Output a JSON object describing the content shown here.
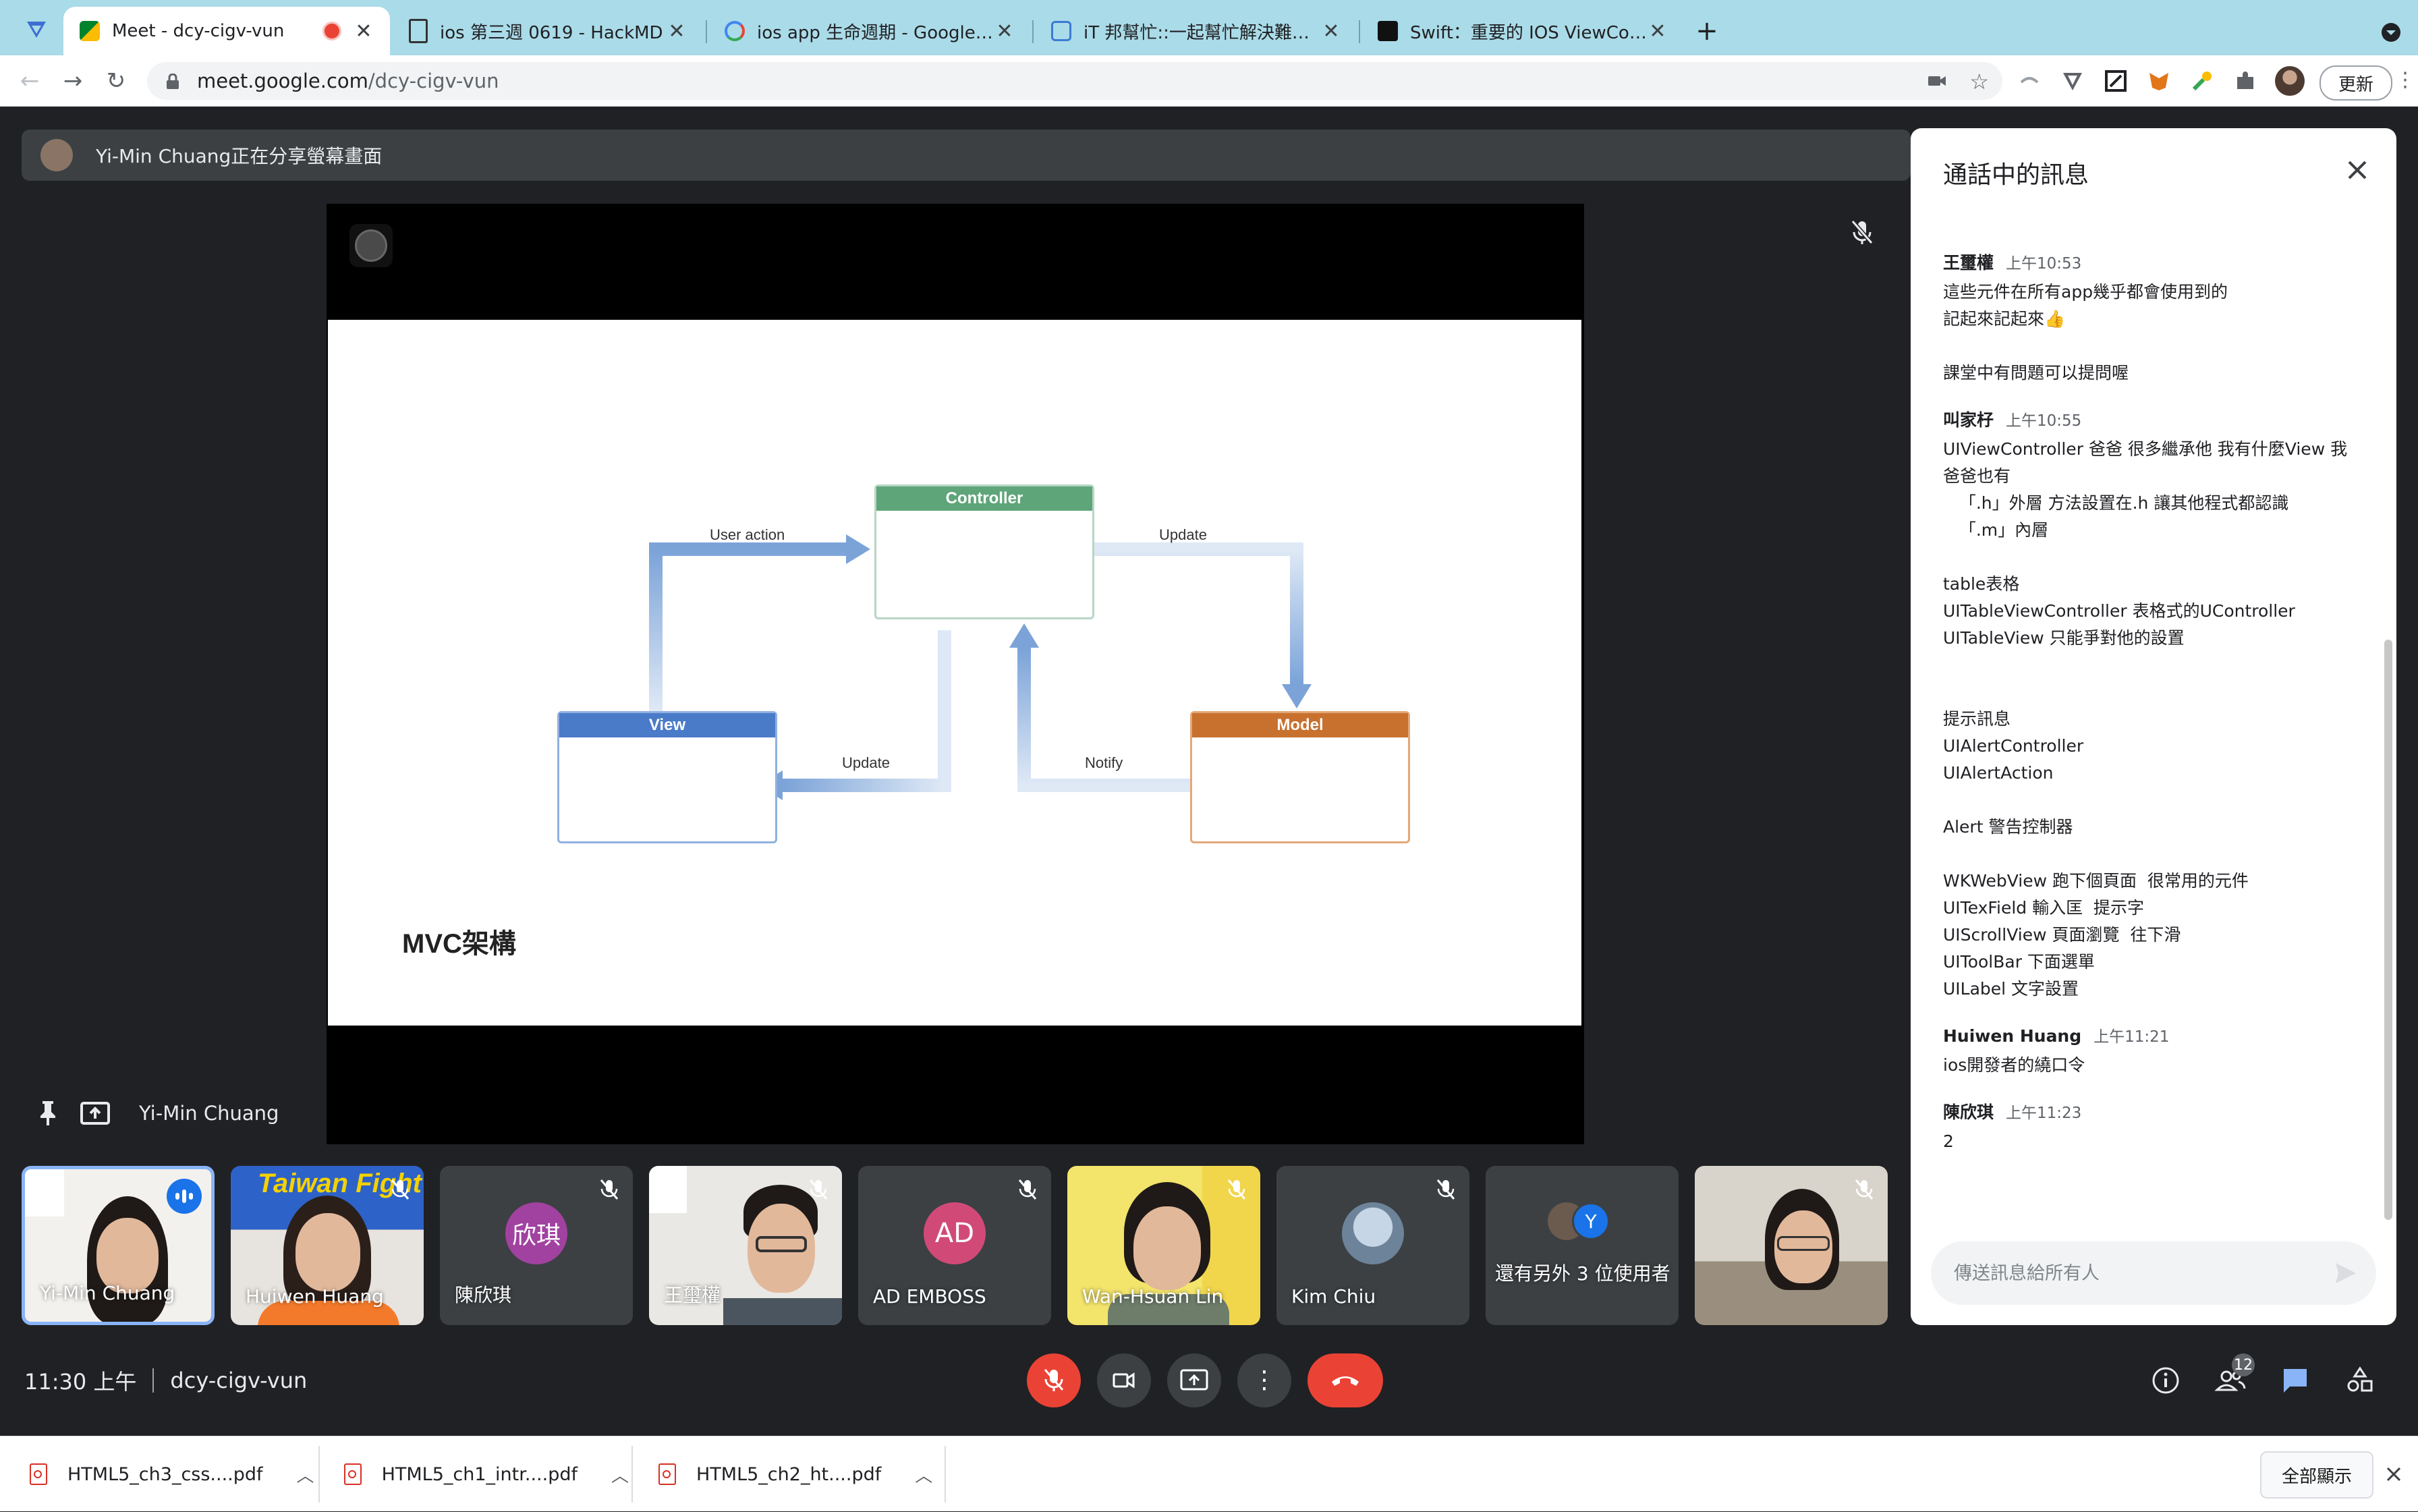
{
  "browser": {
    "tabs": [
      {
        "title": "Meet - dcy-cigv-vun",
        "active": true,
        "recording": true
      },
      {
        "title": "ios 第三週 0619 - HackMD",
        "active": false
      },
      {
        "title": "ios app 生命週期 - Google 搜尋",
        "active": false
      },
      {
        "title": "iT 邦幫忙::一起幫忙解決難題，拯",
        "active": false
      },
      {
        "title": "Swift：重要的 IOS ViewControll",
        "active": false
      }
    ],
    "url_host": "meet.google.com",
    "url_path": "/dcy-cigv-vun",
    "update_label": "更新"
  },
  "meet": {
    "presenting_banner": "Yi-Min Chuang正在分享螢幕畫面",
    "presenter_name": "Yi-Min Chuang",
    "time": "11:30 上午",
    "meeting_code": "dcy-cigv-vun",
    "participant_count": "12"
  },
  "slide": {
    "caption": "MVC架構",
    "boxes": {
      "controller": "Controller",
      "view": "View",
      "model": "Model"
    },
    "labels": {
      "user_action": "User action",
      "update_top": "Update",
      "update_bottom": "Update",
      "notify": "Notify"
    },
    "colors": {
      "controller": "#4c9a6a",
      "view": "#4472c4",
      "model": "#c8702e",
      "arrow": "#7ba3d8"
    }
  },
  "tiles": [
    {
      "name": "Yi-Min Chuang",
      "type": "video",
      "speaking": true
    },
    {
      "name": "Huiwen Huang",
      "type": "video",
      "muted": true
    },
    {
      "name": "陳欣琪",
      "type": "avatar",
      "initials": "欣琪",
      "color": "#a142a0",
      "muted": true
    },
    {
      "name": "王璽權",
      "type": "video",
      "muted": true
    },
    {
      "name": "AD EMBOSS",
      "type": "avatar",
      "initials": "AD",
      "color": "#d14a77",
      "muted": true
    },
    {
      "name": "Wan-Hsuan Lin",
      "type": "video",
      "muted": true
    },
    {
      "name": "Kim Chiu",
      "type": "photo-avatar",
      "muted": true
    },
    {
      "name": "還有另外 3 位使用者",
      "type": "more",
      "initial": "Y"
    },
    {
      "name": "",
      "type": "video",
      "muted": true
    }
  ],
  "chat": {
    "title": "通話中的訊息",
    "input_placeholder": "傳送訊息給所有人",
    "messages": [
      {
        "sender": "王璽權",
        "time": "上午10:53",
        "lines": [
          "這些元件在所有app幾乎都會使用到的",
          "記起來記起來👍",
          "",
          "課堂中有問題可以提問喔"
        ]
      },
      {
        "sender": "叫家杍",
        "time": "上午10:55",
        "lines": [
          "UIViewController 爸爸 很多繼承他 我有什麼View 我",
          "爸爸也有",
          "   「.h」外層 方法設置在.h 讓其他程式都認識",
          "   「.m」內層",
          "",
          "table表格",
          "UITableViewController 表格式的UController",
          "UITableView 只能爭對他的設置",
          "",
          "",
          "提示訊息",
          "UIAlertController",
          "UIAlertAction",
          "",
          "Alert 警告控制器",
          "",
          "WKWebView 跑下個頁面  很常用的元件",
          "UITexField 輸入匡  提示字",
          "UIScrollView 頁面瀏覽  往下滑",
          "UIToolBar 下面選單",
          "UILabel 文字設置"
        ]
      },
      {
        "sender": "Huiwen Huang",
        "time": "上午11:21",
        "lines": [
          "ios開發者的繞口令"
        ]
      },
      {
        "sender": "陳欣琪",
        "time": "上午11:23",
        "lines": [
          "2"
        ]
      }
    ]
  },
  "downloads": [
    {
      "name": "HTML5_ch3_css....pdf"
    },
    {
      "name": "HTML5_ch1_intr....pdf"
    },
    {
      "name": "HTML5_ch2_ht....pdf"
    }
  ],
  "show_all_label": "全部顯示"
}
